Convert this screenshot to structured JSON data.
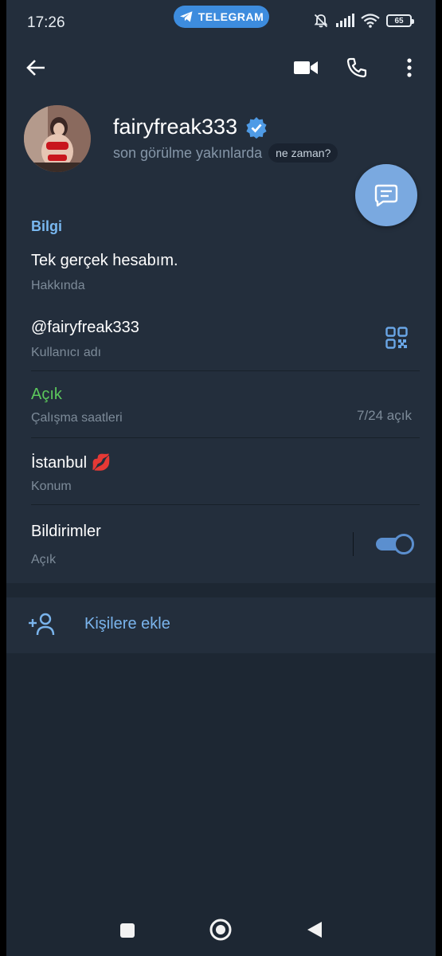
{
  "status_bar": {
    "time": "17:26",
    "app_pill": "TELEGRAM",
    "battery": "65",
    "icons": [
      "mute-bell-icon",
      "signal-icon",
      "wifi-icon",
      "battery-icon"
    ]
  },
  "header": {
    "name": "fairyfreak333",
    "verified": true,
    "last_seen": "son görülme yakınlarda",
    "when_badge": "ne zaman?",
    "icons": [
      "back-arrow-icon",
      "video-call-icon",
      "phone-icon",
      "more-vert-icon"
    ]
  },
  "info": {
    "section_title": "Bilgi",
    "bio": {
      "value": "Tek gerçek hesabım.",
      "label": "Hakkında"
    },
    "username": {
      "value": "@fairyfreak333",
      "label": "Kullanıcı adı"
    },
    "hours": {
      "value": "Açık",
      "label": "Çalışma saatleri",
      "detail": "7/24 açık"
    },
    "location": {
      "value": "İstanbul 💋",
      "label": "Konum"
    },
    "notifications": {
      "value": "Bildirimler",
      "label": "Açık",
      "enabled": true
    }
  },
  "add_contact": {
    "label": "Kişilere ekle"
  },
  "colors": {
    "background": "#1d2733",
    "surface": "#232e3c",
    "accent": "#79b8f0",
    "fab": "#7aa9e0",
    "telegram_pill": "#3d8cde",
    "open_green": "#5cc85c",
    "secondary_text": "#7d8b99"
  }
}
